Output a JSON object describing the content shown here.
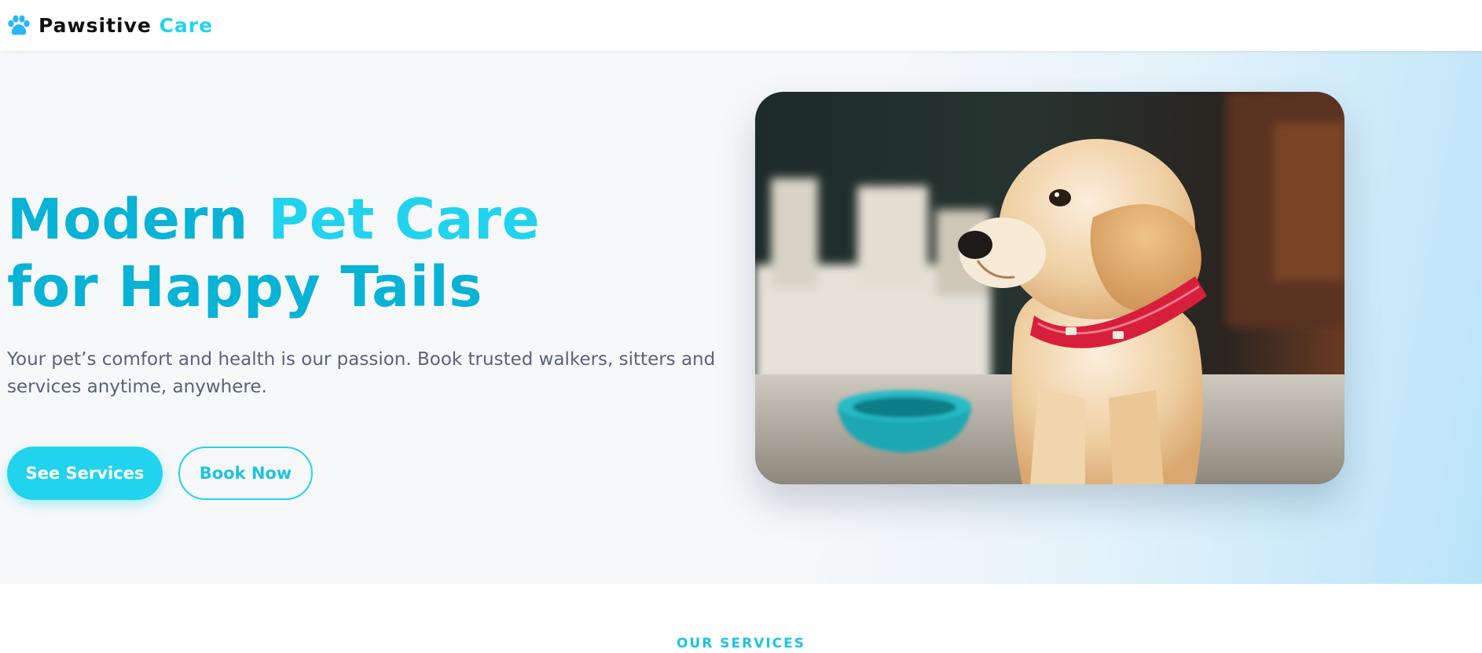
{
  "brand": {
    "name_part1": "Pawsitive",
    "name_part2": "Care",
    "logo_icon": "paw-icon"
  },
  "hero": {
    "title_part1": "Modern ",
    "title_accent": "Pet Care",
    "title_line2": "for Happy Tails",
    "description": "Your pet’s comfort and health is our passion. Book trusted walkers, sitters and services anytime, anywhere.",
    "primary_button": "See Services",
    "secondary_button": "Book Now",
    "image_subject": "puppy-photo"
  },
  "services": {
    "section_label": "OUR SERVICES"
  },
  "colors": {
    "accent": "#22d3ee",
    "title": "#08b3d6",
    "text": "#5a6378",
    "hero_bg": "#f7f8fa"
  }
}
